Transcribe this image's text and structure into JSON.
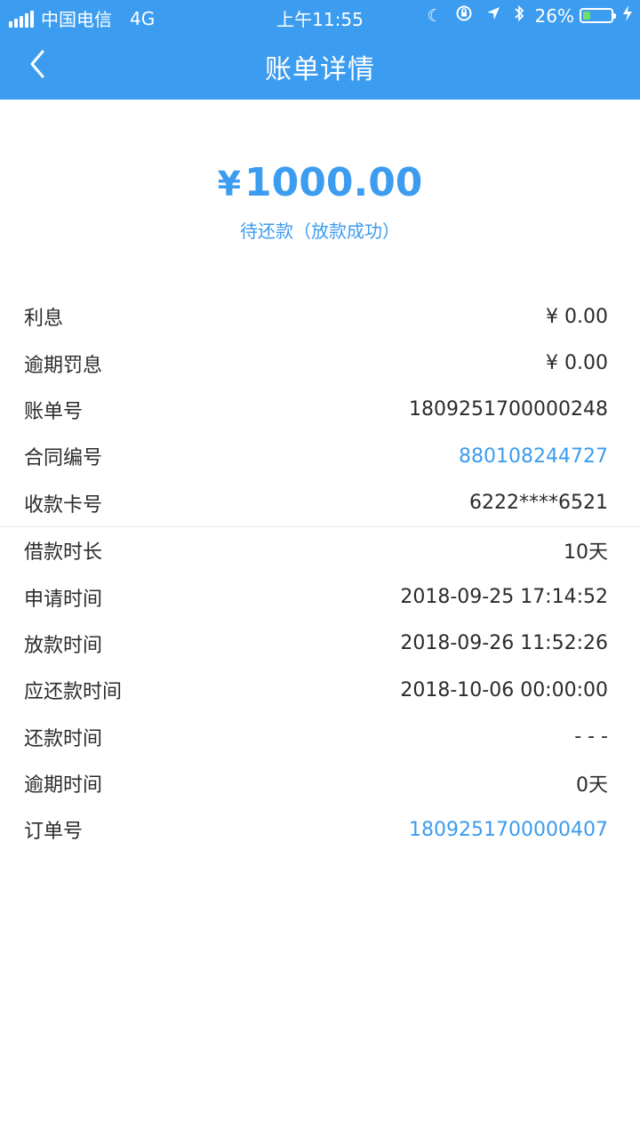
{
  "status_bar": {
    "carrier": "中国电信",
    "network": "4G",
    "time": "上午11:55",
    "battery_percent": "26%",
    "battery_level": 0.26
  },
  "nav": {
    "title": "账单详情"
  },
  "summary": {
    "currency_symbol": "¥",
    "amount": "1000.00",
    "status": "待还款（放款成功）"
  },
  "groups": [
    {
      "rows": [
        {
          "label": "利息",
          "value": "¥ 0.00"
        },
        {
          "label": "逾期罚息",
          "value": "¥ 0.00"
        },
        {
          "label": "账单号",
          "value": "1809251700000248"
        },
        {
          "label": "合同编号",
          "value": "880108244727"
        },
        {
          "label": "收款卡号",
          "value": "6222****6521"
        }
      ]
    },
    {
      "rows": [
        {
          "label": "借款时长",
          "value": "10天"
        },
        {
          "label": "申请时间",
          "value": "2018-09-25 17:14:52"
        },
        {
          "label": "放款时间",
          "value": "2018-09-26 11:52:26"
        },
        {
          "label": "应还款时间",
          "value": "2018-10-06 00:00:00"
        },
        {
          "label": "还款时间",
          "value": "- - -"
        },
        {
          "label": "逾期时间",
          "value": "0天"
        },
        {
          "label": "订单号",
          "value": "1809251700000407"
        }
      ]
    }
  ],
  "colors": {
    "accent": "#3c9cef",
    "text": "#2b2b2b",
    "battery": "#6fe06a"
  }
}
